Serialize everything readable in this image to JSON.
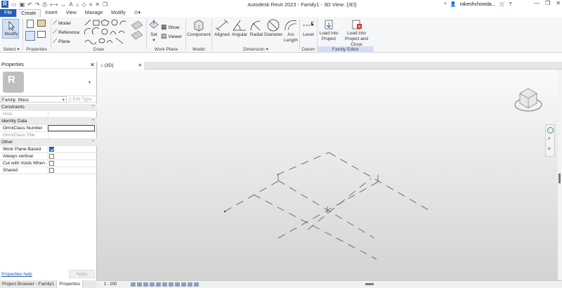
{
  "app": {
    "logo_letter": "R",
    "title": "Autodesk Revit 2023 - Family1 - 3D View: {3D}",
    "user": "rakeshchowda...",
    "window_controls": [
      "minimize",
      "maximize",
      "close"
    ]
  },
  "quick_access": [
    "open-icon",
    "save-icon",
    "undo-icon",
    "redo-icon",
    "print-icon",
    "measure-icon",
    "dimension-icon",
    "tag-icon",
    "3d-view-icon",
    "section-icon",
    "thin-lines-icon",
    "close-hidden-icon",
    "switch-windows-icon"
  ],
  "tabs": [
    "File",
    "Create",
    "Insert",
    "View",
    "Manage",
    "Modify"
  ],
  "active_tab": "Create",
  "ribbon": {
    "select": {
      "button": "Modify",
      "panel": "Select"
    },
    "properties_panel": "Properties",
    "draw": {
      "model": "Model",
      "reference": "Reference",
      "plane": "Plane",
      "panel": "Draw"
    },
    "work_plane": {
      "set": "Set",
      "show": "Show",
      "viewer": "Viewer",
      "panel": "Work Plane"
    },
    "model": {
      "component": "Component",
      "panel": "Model"
    },
    "dimension": {
      "aligned": "Aligned",
      "angular": "Angular",
      "radial": "Radial",
      "diameter": "Diameter",
      "arc_length_1": "Arc",
      "arc_length_2": "Length",
      "panel": "Dimension"
    },
    "datum": {
      "level": "Level",
      "panel": "Datum"
    },
    "family_editor": {
      "load_project_1": "Load into",
      "load_project_2": "Project",
      "load_close_1": "Load into",
      "load_close_2": "Project and Close",
      "panel": "Family Editor"
    }
  },
  "properties": {
    "title": "Properties",
    "type_letter": "R",
    "family": "Family: Mass",
    "edit_type": "Edit Type",
    "groups": [
      {
        "name": "Constraints",
        "rows": [
          {
            "label": "Host",
            "dim": true
          }
        ]
      },
      {
        "name": "Identity Data",
        "rows": [
          {
            "label": "OmniClass Number",
            "box": true
          },
          {
            "label": "OmniClass Title",
            "dim": true
          }
        ]
      },
      {
        "name": "Other",
        "rows": [
          {
            "label": "Work Plane-Based",
            "checked": true
          },
          {
            "label": "Always vertical",
            "checked": false
          },
          {
            "label": "Cut with Voids When ...",
            "checked": false
          },
          {
            "label": "Shared",
            "checked": false
          }
        ]
      }
    ],
    "help_link": "Properties help",
    "apply": "Apply"
  },
  "bottom_tabs": [
    "Project Browser - Family1",
    "Properties"
  ],
  "view": {
    "tab_label": "{3D}",
    "scale": "1 : 200"
  },
  "colors": {
    "accent": "#1f5fb8",
    "contextual": "#d6dcf3"
  }
}
